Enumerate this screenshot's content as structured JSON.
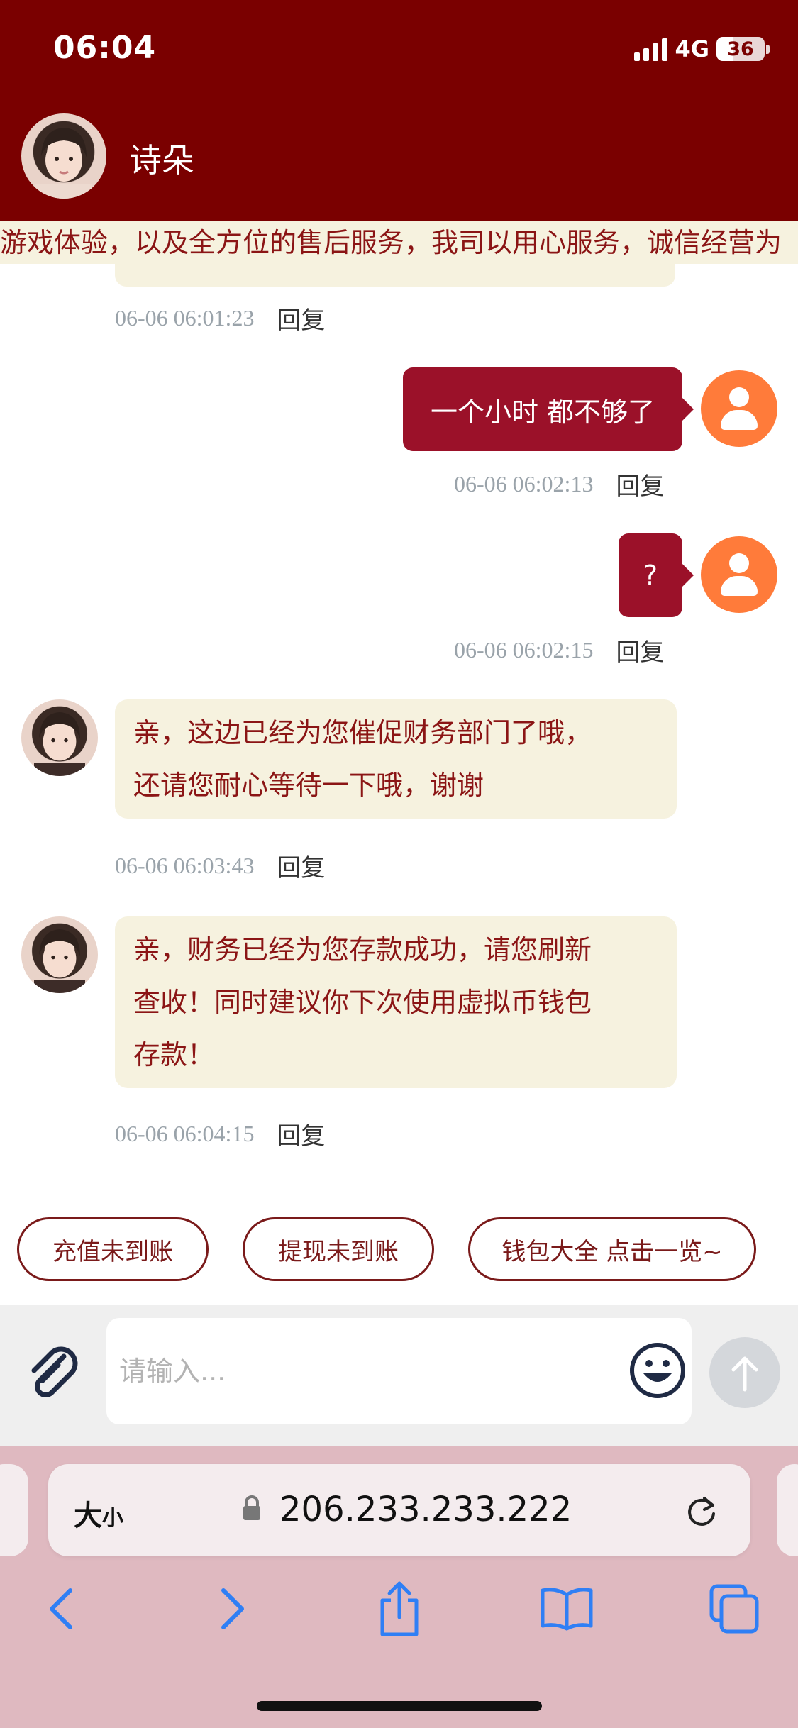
{
  "status_bar": {
    "time": "06:04",
    "network": "4G",
    "battery": "36",
    "battery_level": 0.36,
    "signal_bars": 4
  },
  "header": {
    "agent_name": "诗朵",
    "background_color": "#7a0000"
  },
  "marquee": {
    "text": "游戏体验，以及全方位的售后服务，我司以用心服务，诚信经营为"
  },
  "messages": [
    {
      "direction": "in",
      "timestamp": "06-06 06:01:23",
      "reply": "回复"
    },
    {
      "direction": "out",
      "text": "一个小时 都不够了",
      "timestamp": "06-06 06:02:13",
      "reply": "回复"
    },
    {
      "direction": "out",
      "text": "?",
      "timestamp": "06-06 06:02:15",
      "reply": "回复"
    },
    {
      "direction": "in",
      "lines": [
        "亲，这边已经为您催促财务部门了哦，",
        "还请您耐心等待一下哦，谢谢"
      ],
      "timestamp": "06-06 06:03:43",
      "reply": "回复"
    },
    {
      "direction": "in",
      "lines": [
        "亲，财务已经为您存款成功，请您刷新",
        "查收！同时建议你下次使用虚拟币钱包",
        "存款！"
      ],
      "timestamp": "06-06 06:04:15",
      "reply": "回复"
    }
  ],
  "quick_replies": [
    "充值未到账",
    "提现未到账",
    "钱包大全 点击一览~"
  ],
  "composer": {
    "placeholder": "请输入..."
  },
  "browser": {
    "text_size_big": "大",
    "text_size_small": "小",
    "url": "206.233.233.222"
  },
  "colors": {
    "brand": "#7a0000",
    "outgoing_bubble": "#9b1129",
    "incoming_bubble": "#f6f2df",
    "incoming_text": "#8b1515",
    "user_avatar": "#ff7b3a",
    "browser_chrome": "#dfb9c0"
  }
}
